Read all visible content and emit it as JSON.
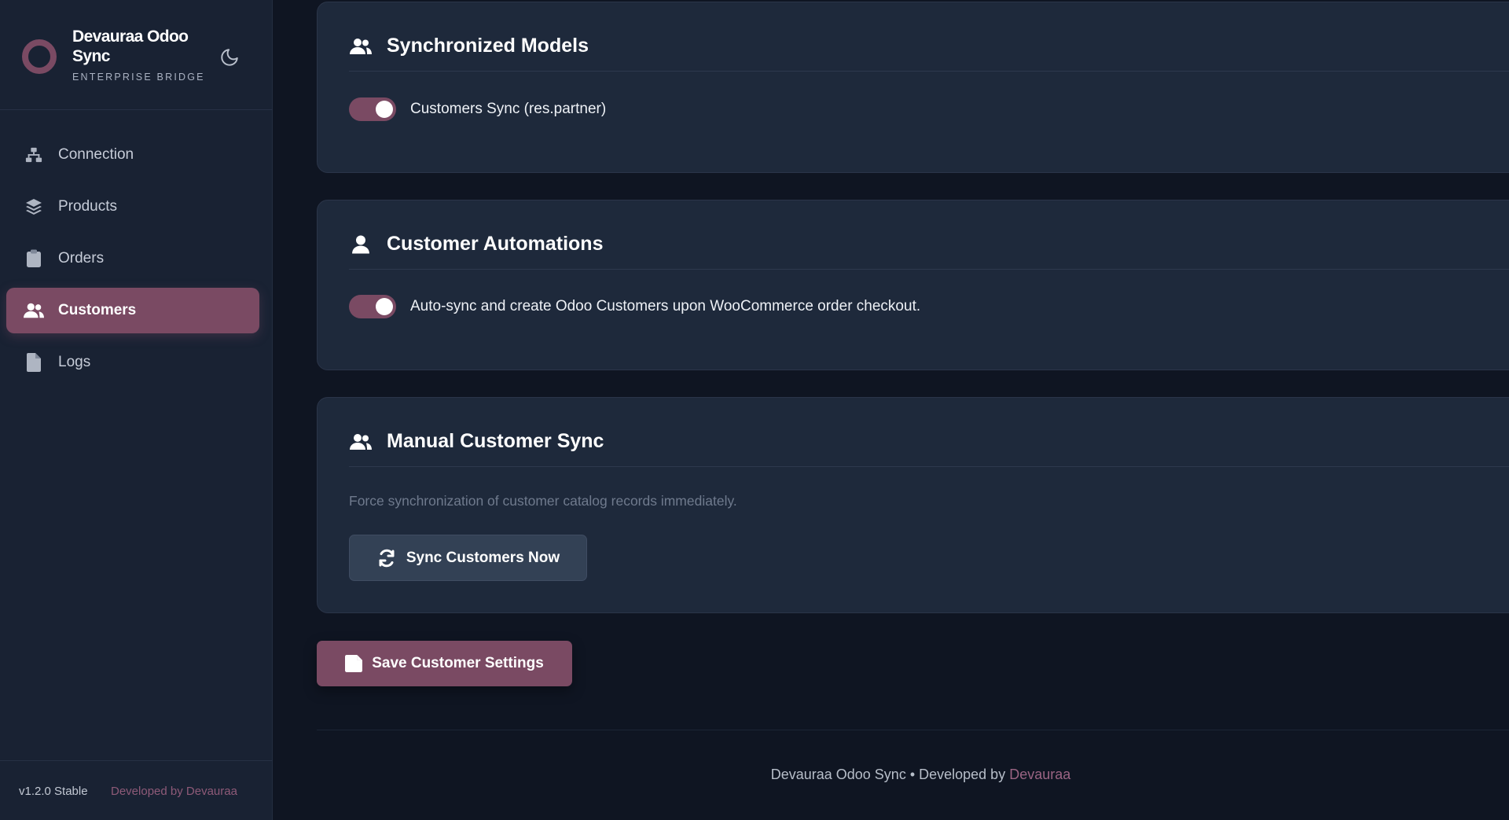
{
  "brand": {
    "title": "Devauraa Odoo Sync",
    "subtitle": "ENTERPRISE BRIDGE",
    "theme_icon": "moon-icon",
    "accent_color": "#7a4a63"
  },
  "sidebar": {
    "items": [
      {
        "label": "Connection",
        "icon": "network-icon",
        "active": false
      },
      {
        "label": "Products",
        "icon": "layers-icon",
        "active": false
      },
      {
        "label": "Orders",
        "icon": "clipboard-icon",
        "active": false
      },
      {
        "label": "Customers",
        "icon": "users-icon",
        "active": true
      },
      {
        "label": "Logs",
        "icon": "file-icon",
        "active": false
      }
    ],
    "version": "v1.2.0 Stable",
    "developer": "Developed by Devauraa"
  },
  "cards": {
    "models": {
      "title": "Synchronized Models",
      "toggle_label": "Customers Sync (res.partner)",
      "toggle_on": true
    },
    "automations": {
      "title": "Customer Automations",
      "toggle_label": "Auto-sync and create Odoo Customers upon WooCommerce order checkout.",
      "toggle_on": true
    },
    "manual": {
      "title": "Manual Customer Sync",
      "description": "Force synchronization of customer catalog records immediately.",
      "button_label": "Sync Customers Now"
    }
  },
  "save_button_label": "Save Customer Settings",
  "footer": {
    "text": "Devauraa Odoo Sync • Developed by",
    "link": "Devauraa"
  }
}
